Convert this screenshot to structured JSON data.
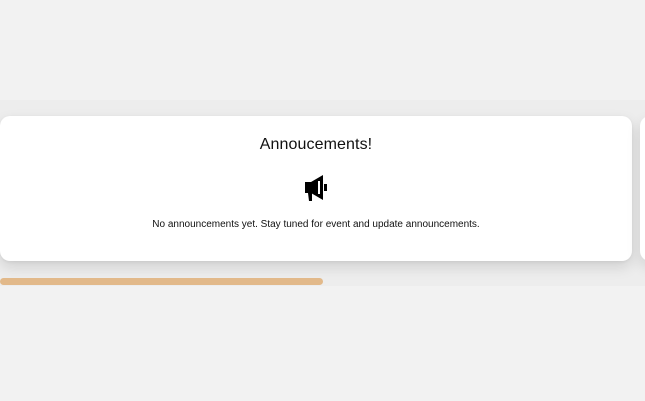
{
  "announcements": {
    "title": "Annoucements!",
    "icon": "megaphone-icon",
    "message": "No announcements yet. Stay tuned for event and update announcements."
  },
  "carousel": {
    "scroll_progress": 0.5,
    "thumb_color": "#e2b98a"
  }
}
